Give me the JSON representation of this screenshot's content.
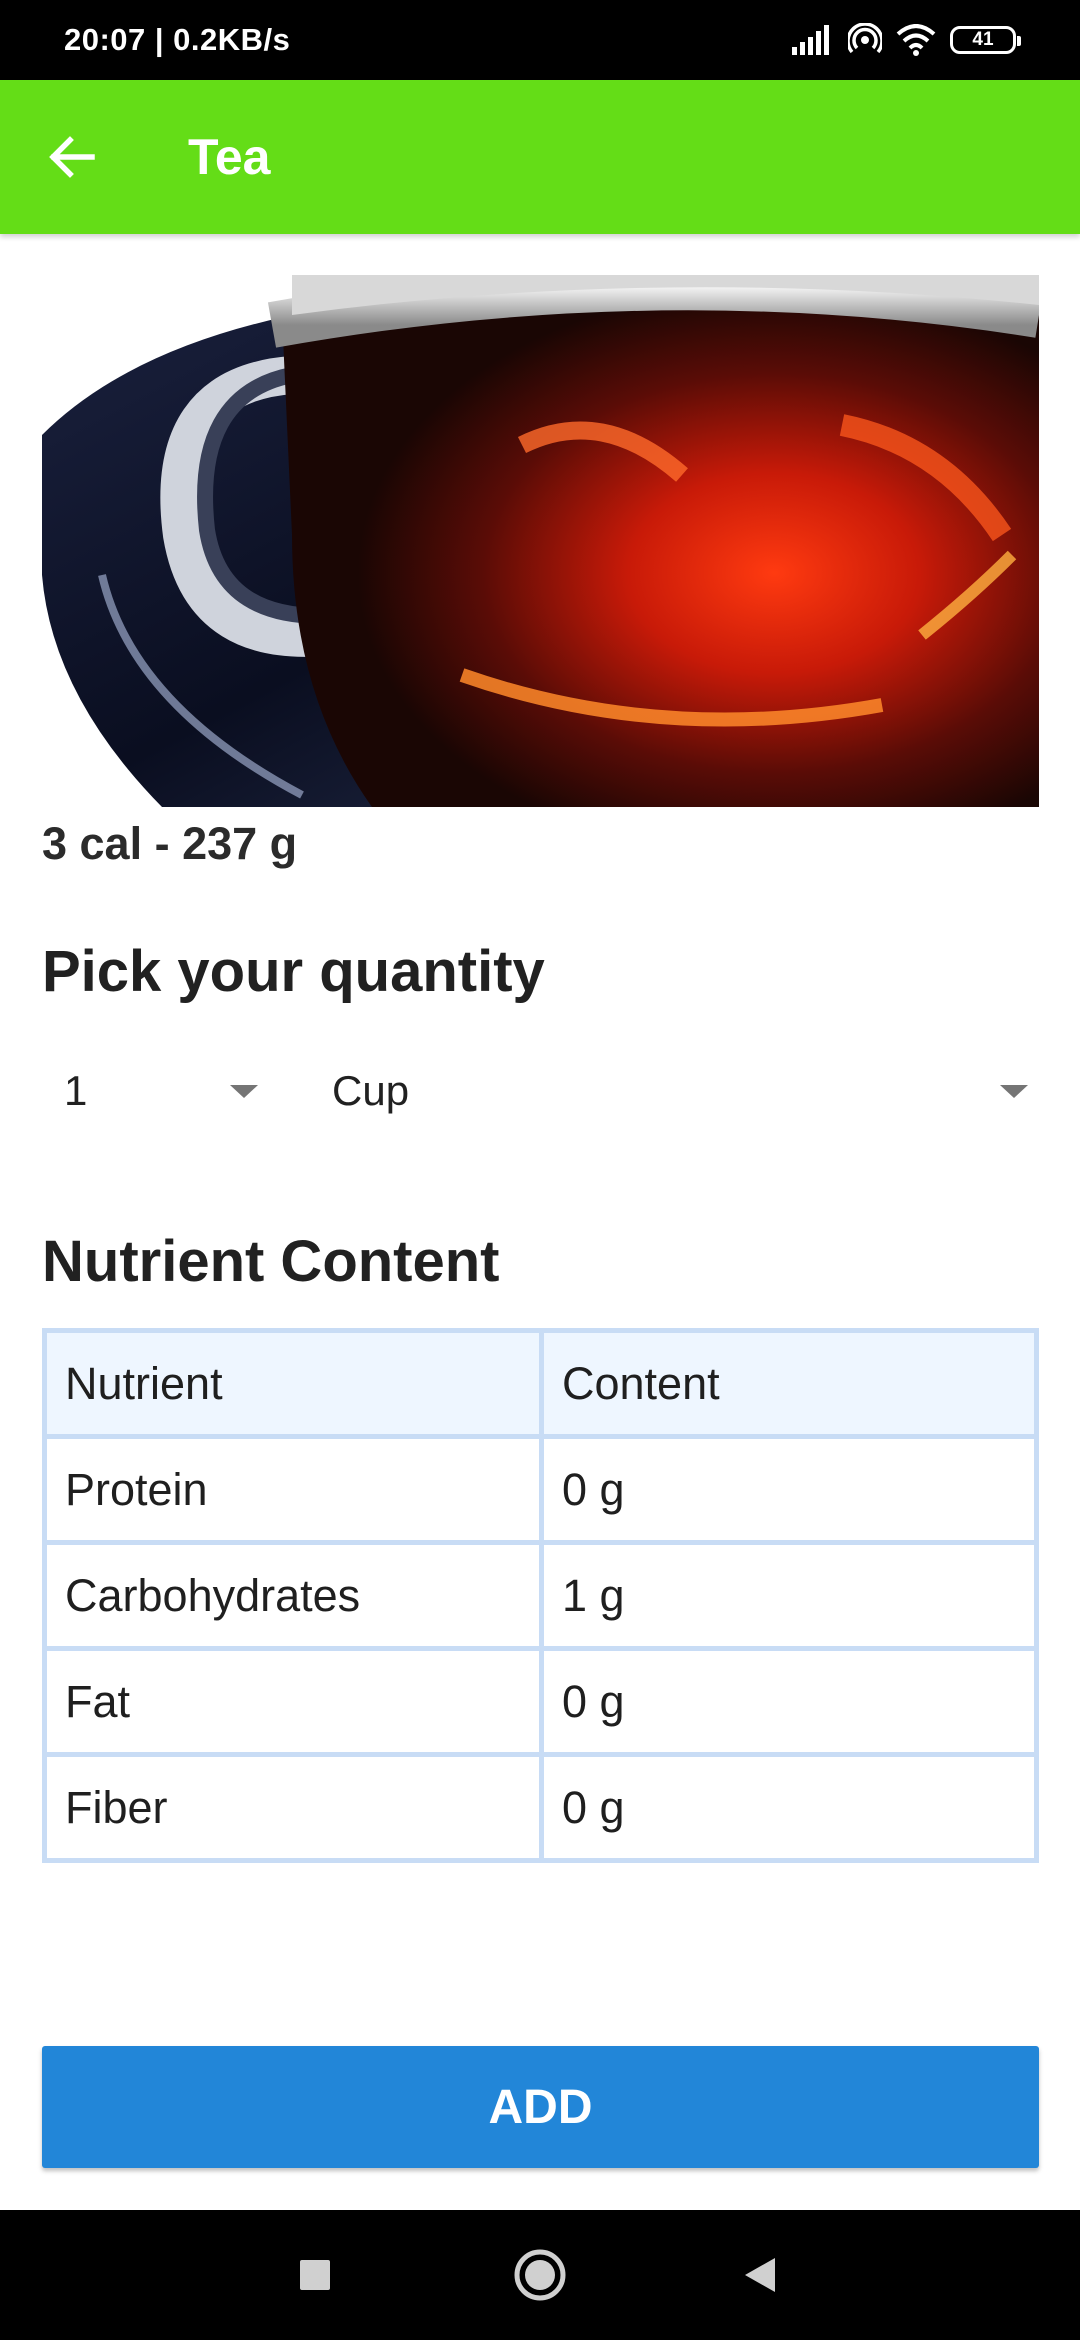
{
  "status_bar": {
    "time_speed": "20:07 | 0.2KB/s",
    "battery_level": "41",
    "icons": [
      "signal-icon",
      "hotspot-icon",
      "wifi-icon",
      "battery-icon"
    ]
  },
  "app_bar": {
    "back_icon": "arrow-left-icon",
    "title": "Tea",
    "color": "#64dd17"
  },
  "food": {
    "image": "tea-cup-image",
    "summary": "3 cal - 237 g"
  },
  "quantity": {
    "title": "Pick your quantity",
    "amount": "1",
    "unit": "Cup"
  },
  "nutrients": {
    "title": "Nutrient Content",
    "headers": [
      "Nutrient",
      "Content"
    ],
    "rows": [
      {
        "name": "Protein",
        "value": "0 g"
      },
      {
        "name": "Carbohydrates",
        "value": "1 g"
      },
      {
        "name": "Fat",
        "value": "0 g"
      },
      {
        "name": "Fiber",
        "value": "0 g"
      }
    ],
    "border_color": "#c8dcf5"
  },
  "actions": {
    "add_label": "ADD",
    "add_color": "#2286d8"
  },
  "nav_bar": {
    "icons": [
      "recents-square-icon",
      "home-circle-icon",
      "back-triangle-icon"
    ]
  }
}
